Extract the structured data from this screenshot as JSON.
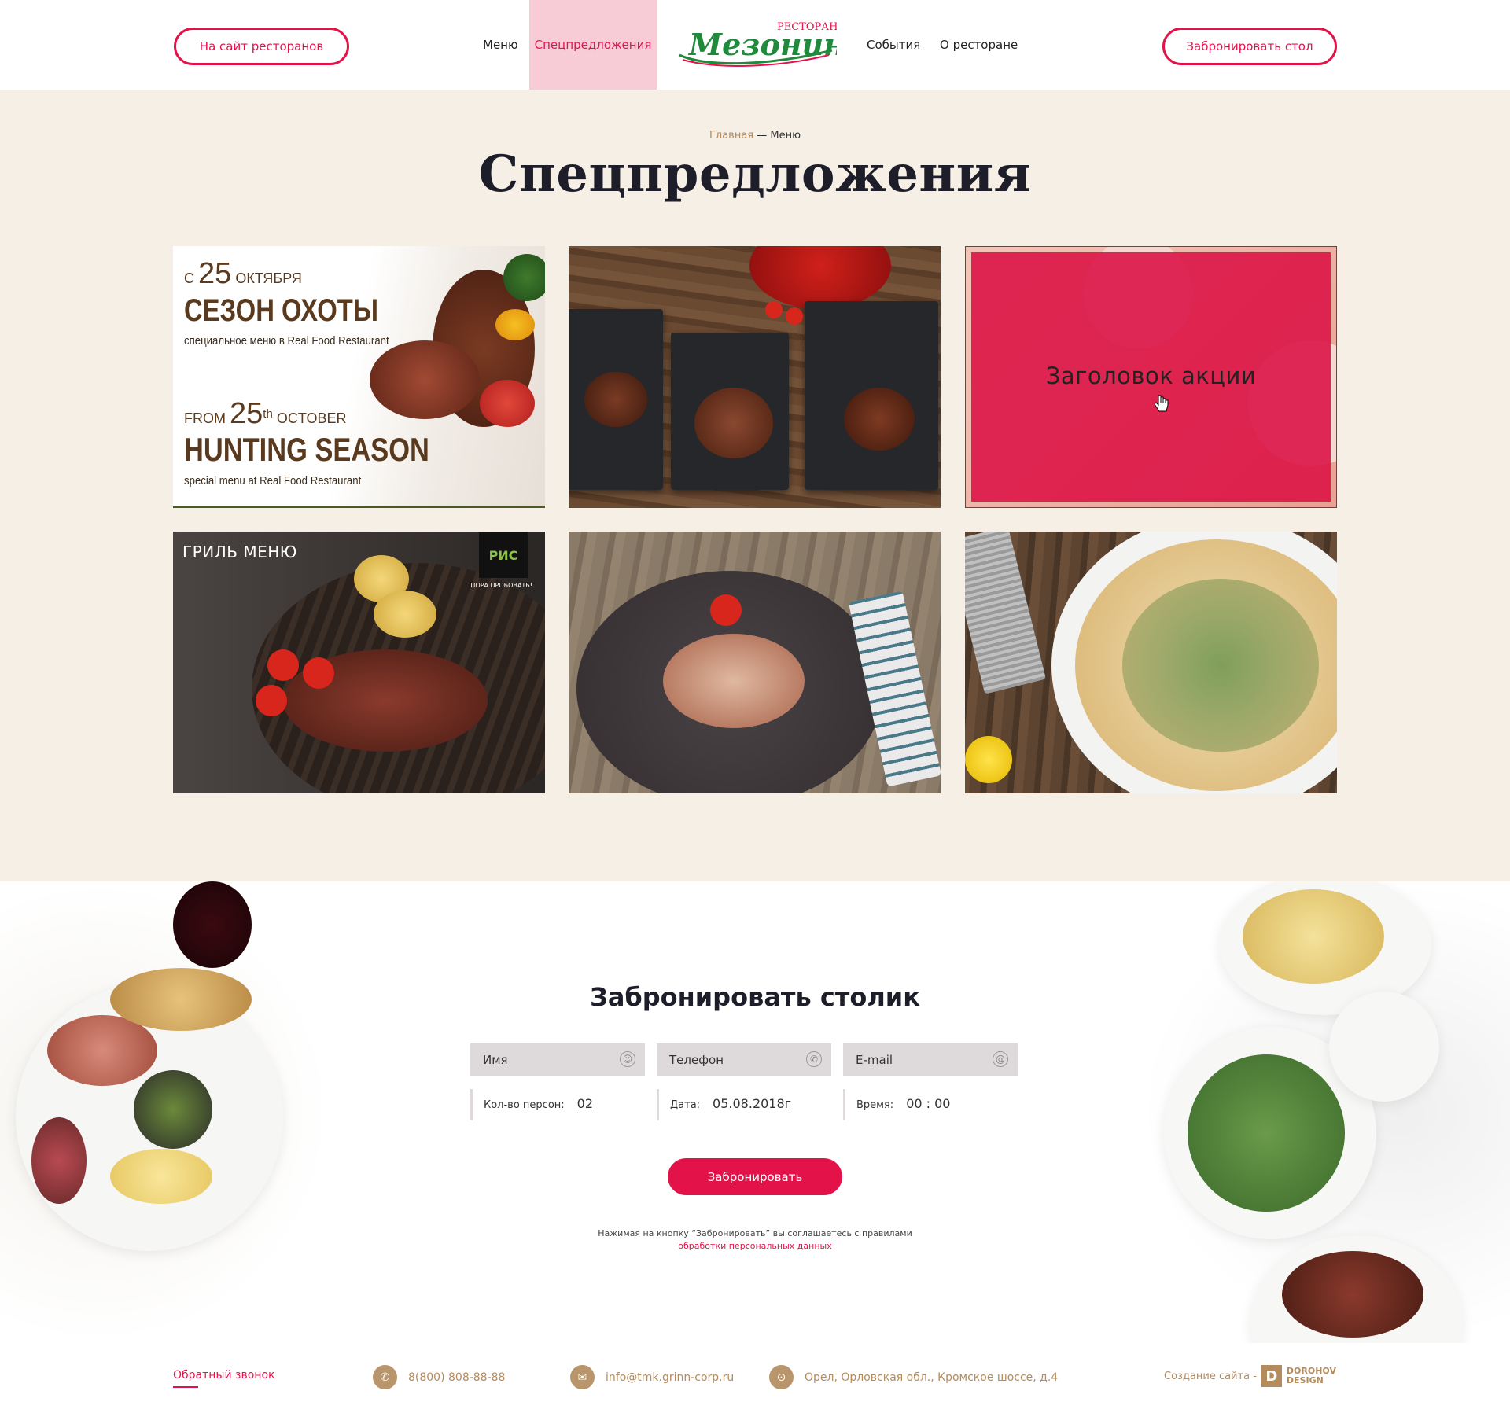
{
  "header": {
    "sites_button": "На сайт ресторанов",
    "nav": [
      {
        "label": "Меню"
      },
      {
        "label": "Спецпредложения"
      },
      {
        "label": "События"
      },
      {
        "label": "О ресторане"
      }
    ],
    "logo": {
      "top_word": "РЕСТОРАН",
      "script_word": "Мезонин"
    },
    "book_button": "Забронировать стол",
    "accent_color": "#e3134a",
    "active_nav_bg": "#f8ccd7"
  },
  "breadcrumb": {
    "home": "Главная",
    "separator": " — ",
    "current": "Меню"
  },
  "page_title": "Спецпредложения",
  "cards": [
    {
      "date_prefix": "С",
      "date_num": "25",
      "date_month": "ОКТЯБРЯ",
      "title_ru": "СЕЗОН ОХОТЫ",
      "sub_ru": "специальное меню в Real Food Restaurant",
      "date2_prefix": "FROM",
      "date2_num": "25",
      "date2_sup": "th",
      "date2_month": "OCTOBER",
      "title_en": "HUNTING SEASON",
      "sub_en": "special menu at Real Food Restaurant"
    },
    {
      "image": "steaks-on-slate-boards"
    },
    {
      "overlay_title": "Заголовок акции",
      "overlay_color": "#dc1446"
    },
    {
      "grill_title": "ГРИЛЬ МЕНЮ",
      "badge": "РИС",
      "badge_note": "ПОРА ПРОБОВАТЬ!"
    },
    {
      "image": "octopus-on-dark-plate"
    },
    {
      "image": "pizza-with-arugula"
    }
  ],
  "booking": {
    "title": "Забронировать столик",
    "fields": [
      {
        "placeholder": "Имя",
        "icon": "person-icon"
      },
      {
        "placeholder": "Телефон",
        "icon": "phone-icon"
      },
      {
        "placeholder": "E-mail",
        "icon": "at-icon"
      }
    ],
    "selects": [
      {
        "label": "Кол-во персон:",
        "value": "02"
      },
      {
        "label": "Дата:",
        "value": "05.08.2018г"
      },
      {
        "label": "Время:",
        "value": "00 : 00"
      }
    ],
    "submit": "Забронировать",
    "terms_text": "Нажимая на кнопку “Забронировать” вы соглашаетесь с правилами",
    "terms_link": "обработки персональных данных"
  },
  "footer": {
    "callback": "Обратный звонок",
    "phone": "8(800) 808-88-88",
    "email": "info@tmk.grinn-corp.ru",
    "address": "Орел, Орловская обл., Кромское шоссе, д.4",
    "credit_label": "Создание сайта -",
    "credit_brand_line1": "DOROHOV",
    "credit_brand_line2": "DESIGN"
  }
}
